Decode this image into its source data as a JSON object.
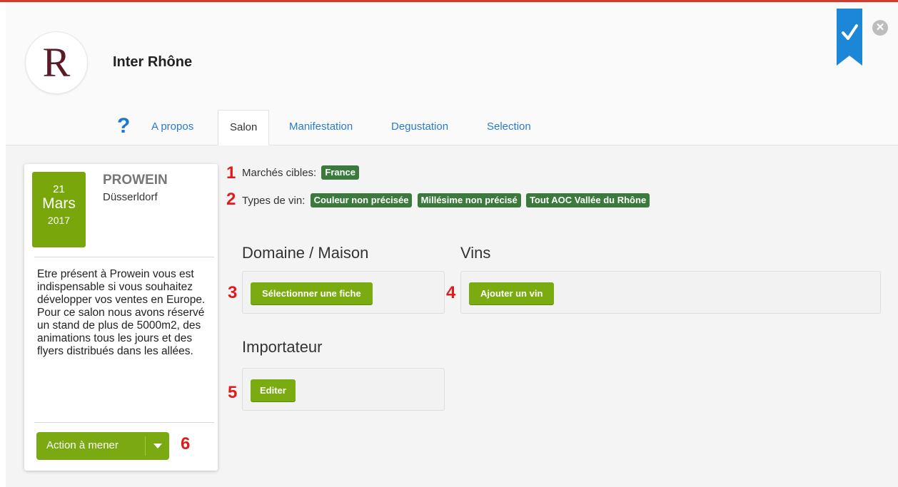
{
  "header": {
    "brand_initial": "R",
    "brand_name": "Inter Rhône",
    "close_glyph": "✕"
  },
  "tabs": [
    {
      "label": "A propos"
    },
    {
      "label": "Salon"
    },
    {
      "label": "Manifestation"
    },
    {
      "label": "Degustation"
    },
    {
      "label": "Selection"
    }
  ],
  "help_glyph": "?",
  "event": {
    "day": "21",
    "month": "Mars",
    "year": "2017",
    "name": "PROWEIN",
    "city": "Düsserldorf",
    "description": "Etre présent à Prowein vous est indispensable si vous souhaitez développer vos ventes en Europe. Pour ce salon nous avons réservé un stand de plus de 5000m2, des animations tous les jours et des flyers distribués dans les allées.",
    "action_label": "Action à mener"
  },
  "markets": {
    "label": "Marchés cibles:",
    "tags": [
      "France"
    ]
  },
  "wine_types": {
    "label": "Types de vin:",
    "tags": [
      "Couleur non précisée",
      "Millésime non précisé",
      "Tout AOC Vallée du Rhône"
    ]
  },
  "sections": {
    "domaine": {
      "title": "Domaine / Maison",
      "button": "Sélectionner une fiche"
    },
    "vins": {
      "title": "Vins",
      "button": "Ajouter un vin"
    },
    "importateur": {
      "title": "Importateur",
      "button": "Editer"
    }
  },
  "markers": [
    "1",
    "2",
    "3",
    "4",
    "5",
    "6"
  ],
  "colors": {
    "accent_green": "#7aab10",
    "tag_green": "#3b7a3c",
    "link_blue": "#2a7cc7",
    "marker_red": "#e01b1b",
    "bookmark_blue": "#1b87d6"
  },
  "icons": {
    "bookmark": "bookmark-check-icon",
    "close": "close-icon",
    "help": "question-icon",
    "dropdown": "caret-down-icon"
  }
}
